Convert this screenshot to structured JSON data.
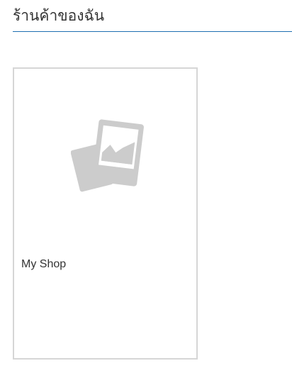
{
  "header": {
    "title": "ร้านค้าของฉัน"
  },
  "shops": [
    {
      "name": "My Shop",
      "image_icon": "image-placeholder-icon"
    }
  ],
  "colors": {
    "accent_rule": "#1f6fb2",
    "card_border": "#d6d6d6",
    "placeholder_icon": "#cccccc",
    "text": "#333333"
  }
}
